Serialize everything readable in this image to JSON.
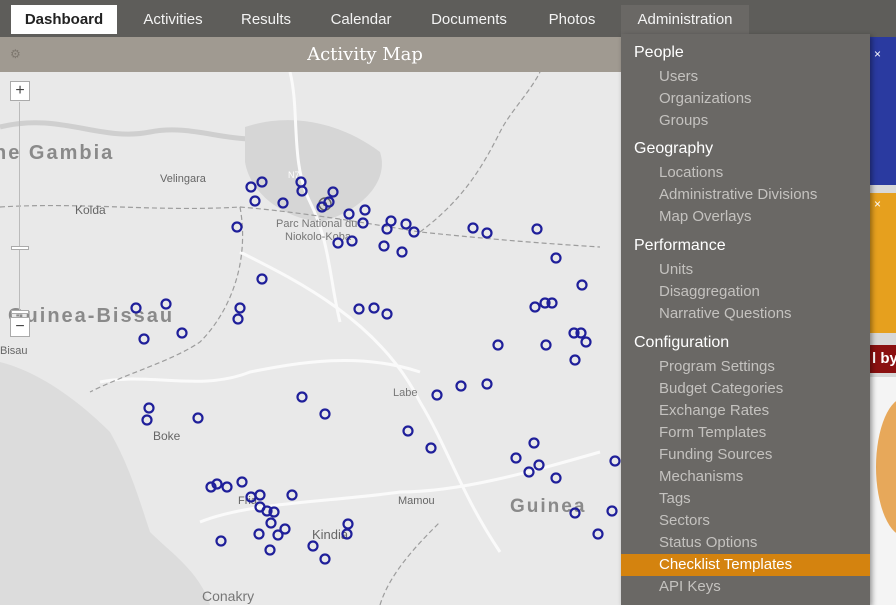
{
  "nav": {
    "tabs": [
      "Dashboard",
      "Activities",
      "Results",
      "Calendar",
      "Documents",
      "Photos",
      "Administration"
    ],
    "active": "Dashboard"
  },
  "map": {
    "title": "Activity Map",
    "zoom_in": "+",
    "zoom_out": "−",
    "labels": {
      "gambia": "he Gambia",
      "velingara": "Velingara",
      "kolda": "Kolda",
      "guinea_bissau": "Guinea-Bissau",
      "bissau": "Bisau",
      "parc": "Parc National du",
      "parc2": "Niokolo-Koba",
      "n7": "N7",
      "boke": "Boke",
      "fria": "Fria",
      "kindia": "Kindia",
      "conakry": "Conakry",
      "labe": "Labe",
      "mamou": "Mamou",
      "guinea": "Guinea"
    }
  },
  "right_panel": {
    "fragment_text": "l by"
  },
  "admin_menu": {
    "groups": [
      {
        "label": "People",
        "items": [
          "Users",
          "Organizations",
          "Groups"
        ]
      },
      {
        "label": "Geography",
        "items": [
          "Locations",
          "Administrative Divisions",
          "Map Overlays"
        ]
      },
      {
        "label": "Performance",
        "items": [
          "Units",
          "Disaggregation",
          "Narrative Questions"
        ]
      },
      {
        "label": "Configuration",
        "items": [
          "Program Settings",
          "Budget Categories",
          "Exchange Rates",
          "Form Templates",
          "Funding Sources",
          "Mechanisms",
          "Tags",
          "Sectors",
          "Status Options",
          "Checklist Templates",
          "API Keys"
        ]
      }
    ],
    "highlighted": "Checklist Templates"
  },
  "colors": {
    "nav_bg": "#5e5d5a",
    "menu_bg": "#6a6865",
    "highlight": "#d4830f",
    "map_header": "#a09a91",
    "marker": "#1f1f9a",
    "right_blue": "#2a3aa0",
    "right_orange": "#e6a01e",
    "right_red": "#8a1010"
  }
}
